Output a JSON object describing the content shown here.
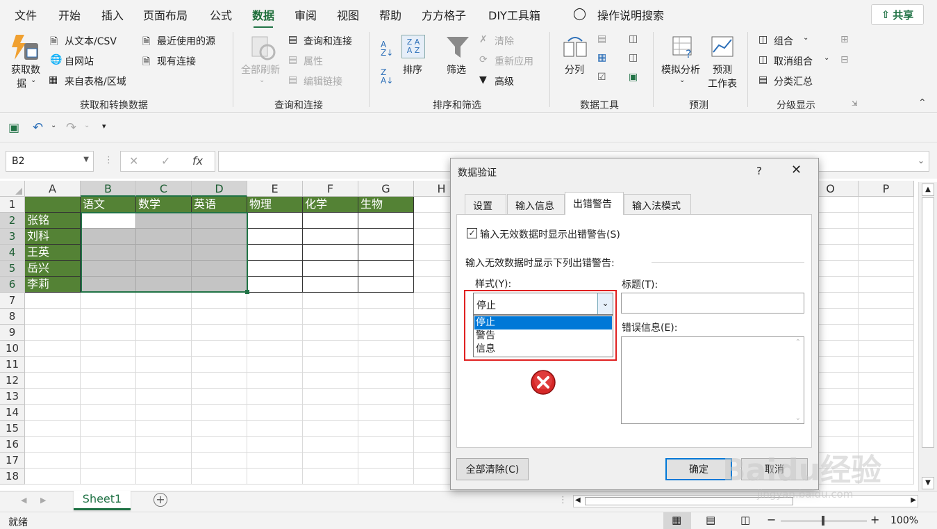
{
  "tabs": [
    "文件",
    "开始",
    "插入",
    "页面布局",
    "公式",
    "数据",
    "审阅",
    "视图",
    "帮助",
    "方方格子",
    "DIY工具箱"
  ],
  "active_tab": "数据",
  "tell_me": "操作说明搜索",
  "share": "共享",
  "ribbon": {
    "get_data_1": "获取数",
    "get_data_2": "据",
    "from_text": "从文本/CSV",
    "from_web": "自网站",
    "from_table": "来自表格/区域",
    "recent_sources": "最近使用的源",
    "existing_conn": "现有连接",
    "group_get": "获取和转换数据",
    "refresh_all": "全部刷新",
    "queries_conn": "查询和连接",
    "properties": "属性",
    "edit_links": "编辑链接",
    "group_queries": "查询和连接",
    "sort": "排序",
    "filter": "筛选",
    "clear": "清除",
    "reapply": "重新应用",
    "advanced": "高级",
    "group_sort": "排序和筛选",
    "text_to_col": "分列",
    "group_datatools": "数据工具",
    "whatif": "模拟分析",
    "forecast_1": "预测",
    "forecast_2": "工作表",
    "group_forecast": "预测",
    "group_btn": "组合",
    "ungroup_btn": "取消组合",
    "subtotal": "分类汇总",
    "group_outline": "分级显示"
  },
  "namebox": "B2",
  "fx": "fx",
  "columns": [
    "A",
    "B",
    "C",
    "D",
    "E",
    "F",
    "G",
    "H",
    "",
    "",
    "",
    "",
    "",
    "",
    "O",
    "P"
  ],
  "rows": [
    "1",
    "2",
    "3",
    "4",
    "5",
    "6",
    "7",
    "8",
    "9",
    "10",
    "11",
    "12",
    "13",
    "14",
    "15",
    "16",
    "17",
    "18"
  ],
  "headers": [
    "语文",
    "数学",
    "英语",
    "物理",
    "化学",
    "生物"
  ],
  "names": [
    "张铭",
    "刘科",
    "王英",
    "岳兴",
    "李莉"
  ],
  "sheet": "Sheet1",
  "status": "就绪",
  "zoom": "100%",
  "dialog": {
    "title": "数据验证",
    "help": "?",
    "tabs": [
      "设置",
      "输入信息",
      "出错警告",
      "输入法模式"
    ],
    "active_tab": "出错警告",
    "show_error_check": "输入无效数据时显示出错警告(S)",
    "checked": true,
    "section": "输入无效数据时显示下列出错警告:",
    "style_label": "样式(Y):",
    "style_value": "停止",
    "style_options": [
      "停止",
      "警告",
      "信息"
    ],
    "title_label": "标题(T):",
    "title_value": "",
    "message_label": "错误信息(E):",
    "message_value": "",
    "clear_all": "全部清除(C)",
    "ok": "确定",
    "cancel": "取消"
  },
  "watermark": {
    "brand": "Baidu经验",
    "url": "jingyan.baidu.com"
  },
  "colors": {
    "header_green": "#548235",
    "excel_green": "#217346",
    "selection_gray": "#c4c4c4",
    "highlight_red": "#e02020"
  }
}
